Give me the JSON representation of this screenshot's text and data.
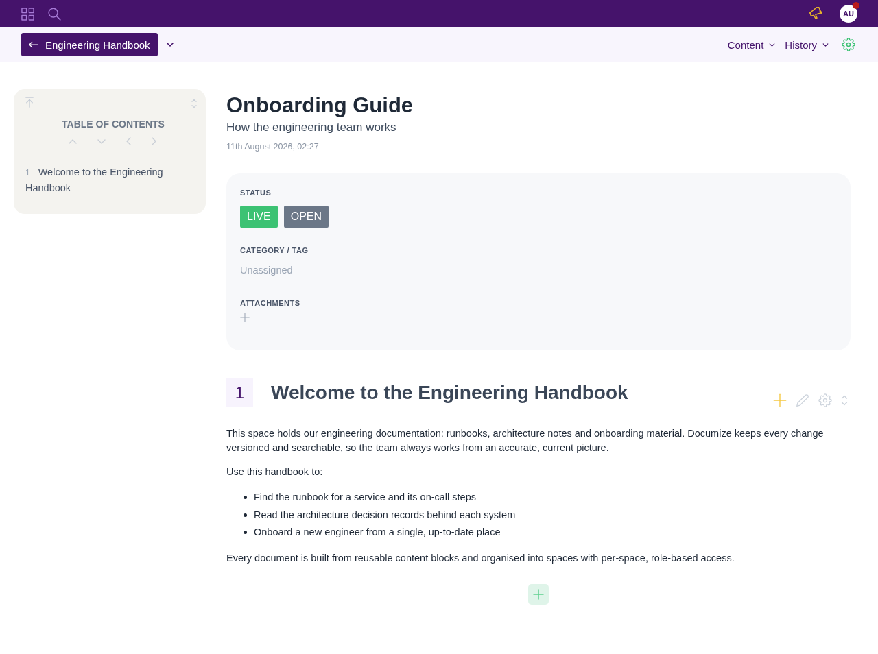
{
  "top_bar": {
    "avatar": {
      "initials": "AU",
      "notification": true
    }
  },
  "space_bar": {
    "space_button": "Engineering Handbook",
    "menus": [
      {
        "label": "Content"
      },
      {
        "label": "History"
      }
    ]
  },
  "toc": {
    "title": "TABLE OF CONTENTS",
    "entries": [
      {
        "number": "1",
        "label": "Welcome to the Engineering Handbook"
      }
    ]
  },
  "document": {
    "title": "Onboarding Guide",
    "subtitle": "How the engineering team works",
    "date": "11th August 2026, 02:27"
  },
  "meta": {
    "status": {
      "label": "STATUS",
      "badges": [
        {
          "label": "LIVE",
          "color": "#3cc273"
        },
        {
          "label": "OPEN",
          "color": "#6b7787"
        }
      ]
    },
    "category": {
      "label": "CATEGORY / TAG",
      "value": "Unassigned"
    },
    "attachments": {
      "label": "ATTACHMENTS"
    }
  },
  "sections": [
    {
      "number": "1",
      "heading": "Welcome to the Engineering Handbook",
      "blocks": [
        {
          "kind": "paragraph",
          "text": "This space holds our engineering documentation: runbooks, architecture notes and onboarding material. Documize keeps every change versioned and searchable, so the team always works from an accurate, current picture."
        },
        {
          "kind": "paragraph",
          "text": "Use this handbook to:"
        },
        {
          "kind": "list",
          "items": [
            "Find the runbook for a service and its on-call steps",
            "Read the architecture decision records behind each system",
            "Onboard a new engineer from a single, up-to-date place"
          ]
        },
        {
          "kind": "paragraph",
          "text": "Every document is built from reusable content blocks and organised into spaces with per-space, role-based access."
        }
      ]
    }
  ]
}
